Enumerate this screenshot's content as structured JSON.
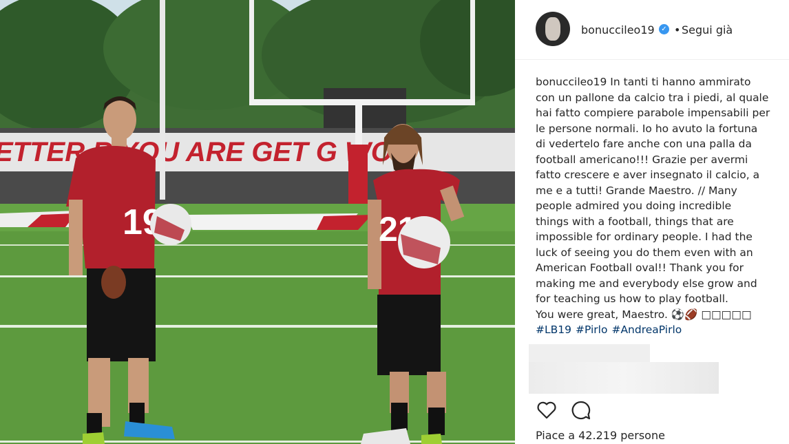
{
  "post": {
    "image_alt": "",
    "banner_text": "ETTER  R YOU ARE GET   G WO"
  },
  "header": {
    "username": "bonuccileo19",
    "separator": "•",
    "follow_label": "Segui già"
  },
  "caption": {
    "username": "bonuccileo19",
    "lines": [
      " In tanti ti hanno ammirato",
      "con un pallone da calcio tra i piedi, al quale",
      "hai fatto compiere parabole impensabili per",
      "le persone normali. Io ho avuto la fortuna",
      "di vedertelo fare anche con una palla da",
      "football americano!!! Grazie per avermi",
      "fatto crescere e aver insegnato il calcio, a",
      "me e a tutti! Grande Maestro. // Many",
      "people admired you doing incredible",
      "things with a football, things that are",
      "impossible for ordinary people. I had the",
      "luck of seeing you do them even with an",
      "American Football oval!! Thank you for",
      "making me and everybody else grow and",
      "for teaching us how to play football.",
      "You were great, Maestro. ⚽🏈 □□□□□"
    ],
    "hashtags": [
      "#LB19",
      "#Pirlo",
      "#AndreaPirlo"
    ]
  },
  "actions": {
    "like_icon": "heart-icon",
    "comment_icon": "comment-icon"
  },
  "likes_text": "Piace a 42.219 persone",
  "colors": {
    "link": "#003569",
    "verified": "#3897f0",
    "jersey": "#b2202c"
  }
}
